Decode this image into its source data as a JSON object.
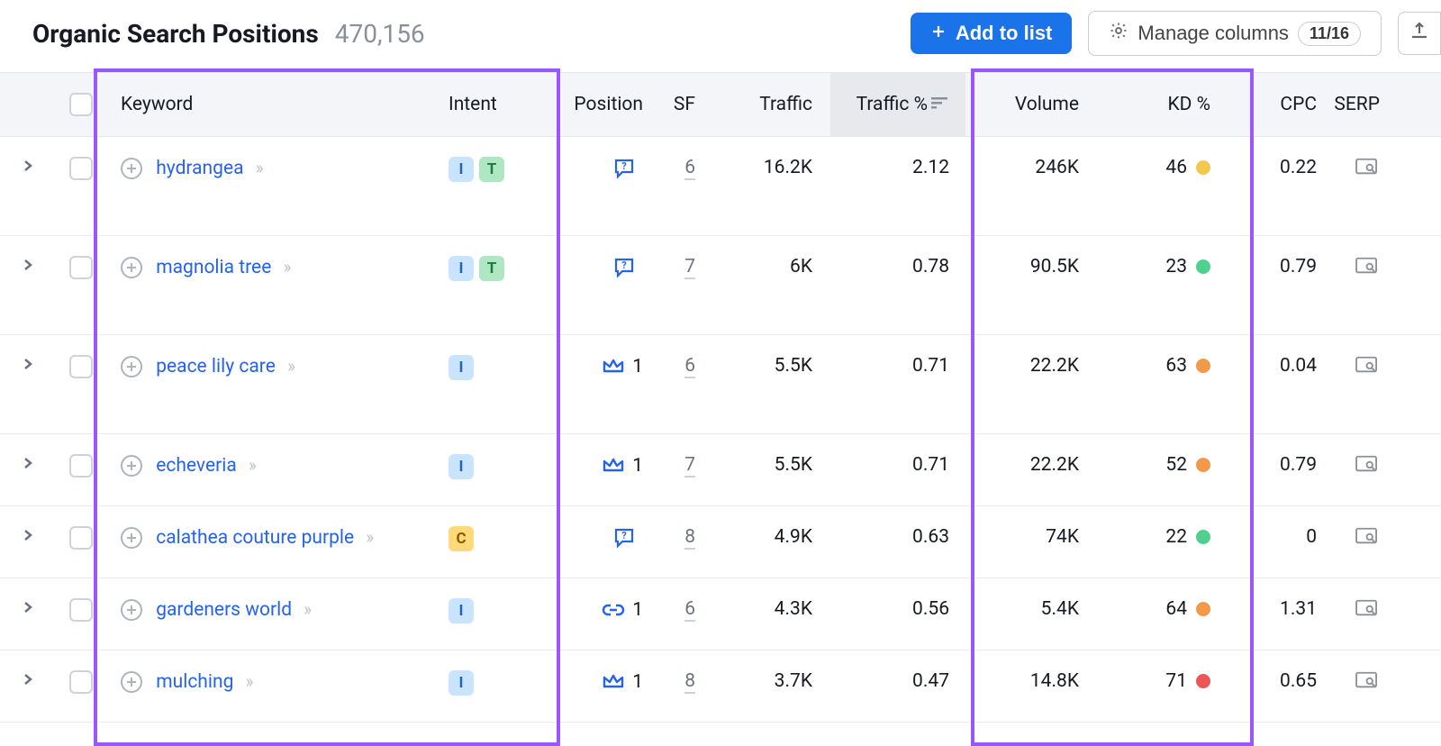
{
  "header": {
    "title": "Organic Search Positions",
    "count": "470,156",
    "add_to_list": "Add to list",
    "manage_columns": "Manage columns",
    "columns_badge": "11/16"
  },
  "columns": {
    "keyword": "Keyword",
    "intent": "Intent",
    "position": "Position",
    "sf": "SF",
    "traffic": "Traffic",
    "traffic_pct": "Traffic %",
    "volume": "Volume",
    "kd": "KD %",
    "cpc": "CPC",
    "serp": "SERP"
  },
  "kd_colors": {
    "yellow": "#f2c94c",
    "green": "#4fd08e",
    "orange": "#f2994a",
    "red": "#eb5757"
  },
  "rows": [
    {
      "keyword": "hydrangea",
      "intents": [
        "I",
        "T"
      ],
      "pos_icon": "question",
      "pos_value": "",
      "sf": "6",
      "traffic": "16.2K",
      "traffic_pct": "2.12",
      "volume": "246K",
      "kd": "46",
      "kd_color": "yellow",
      "cpc": "0.22",
      "tall": true
    },
    {
      "keyword": "magnolia tree",
      "intents": [
        "I",
        "T"
      ],
      "pos_icon": "question",
      "pos_value": "",
      "sf": "7",
      "traffic": "6K",
      "traffic_pct": "0.78",
      "volume": "90.5K",
      "kd": "23",
      "kd_color": "green",
      "cpc": "0.79",
      "tall": true
    },
    {
      "keyword": "peace lily care",
      "intents": [
        "I"
      ],
      "pos_icon": "crown",
      "pos_value": "1",
      "sf": "6",
      "traffic": "5.5K",
      "traffic_pct": "0.71",
      "volume": "22.2K",
      "kd": "63",
      "kd_color": "orange",
      "cpc": "0.04",
      "tall": true
    },
    {
      "keyword": "echeveria",
      "intents": [
        "I"
      ],
      "pos_icon": "crown",
      "pos_value": "1",
      "sf": "7",
      "traffic": "5.5K",
      "traffic_pct": "0.71",
      "volume": "22.2K",
      "kd": "52",
      "kd_color": "orange",
      "cpc": "0.79",
      "tall": false
    },
    {
      "keyword": "calathea couture purple",
      "intents": [
        "C"
      ],
      "pos_icon": "question",
      "pos_value": "",
      "sf": "8",
      "traffic": "4.9K",
      "traffic_pct": "0.63",
      "volume": "74K",
      "kd": "22",
      "kd_color": "green",
      "cpc": "0",
      "tall": false
    },
    {
      "keyword": "gardeners world",
      "intents": [
        "I"
      ],
      "pos_icon": "link",
      "pos_value": "1",
      "sf": "6",
      "traffic": "4.3K",
      "traffic_pct": "0.56",
      "volume": "5.4K",
      "kd": "64",
      "kd_color": "orange",
      "cpc": "1.31",
      "tall": false
    },
    {
      "keyword": "mulching",
      "intents": [
        "I"
      ],
      "pos_icon": "crown",
      "pos_value": "1",
      "sf": "8",
      "traffic": "3.7K",
      "traffic_pct": "0.47",
      "volume": "14.8K",
      "kd": "71",
      "kd_color": "red",
      "cpc": "0.65",
      "tall": false
    }
  ]
}
